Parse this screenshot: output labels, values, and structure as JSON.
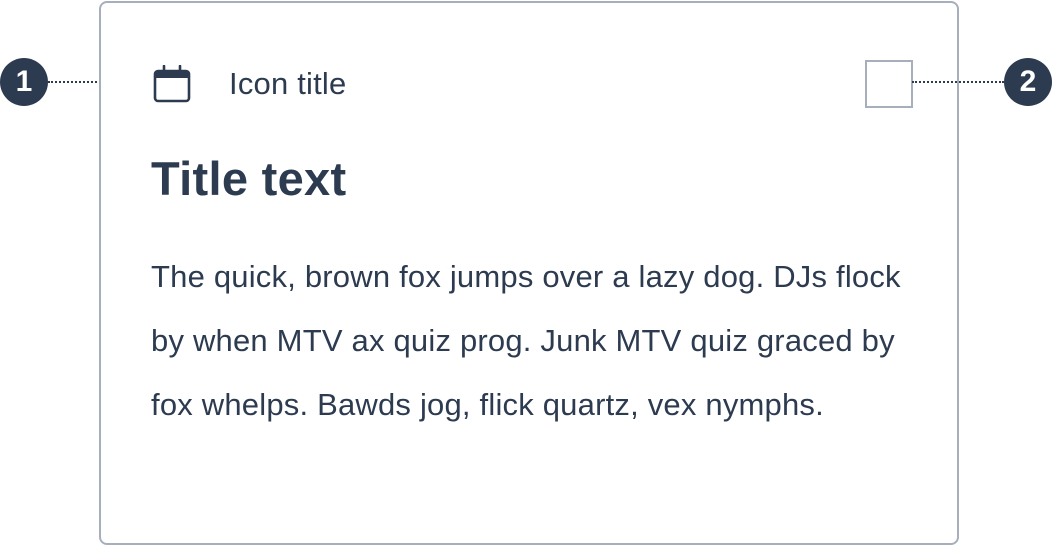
{
  "card": {
    "icon": "calendar-icon",
    "icon_title": "Icon title",
    "title": "Title text",
    "body": "The quick, brown fox jumps over a lazy dog. DJs flock by when MTV ax quiz prog. Junk MTV quiz graced by fox whelps. Bawds jog, flick quartz, vex nymphs.",
    "checkbox_checked": false
  },
  "annotations": {
    "marker_1": "1",
    "marker_2": "2"
  },
  "colors": {
    "text": "#2d3b50",
    "border": "#a7afbc",
    "background": "#ffffff",
    "marker": "#2d3b50"
  }
}
